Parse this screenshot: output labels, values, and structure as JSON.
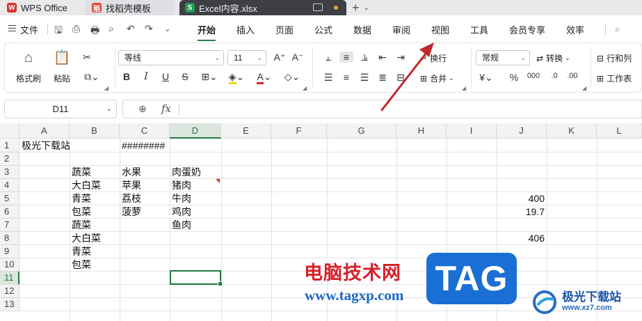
{
  "titlebar": {
    "tabs": [
      {
        "label": "WPS Office",
        "icon": "wps-logo-icon"
      },
      {
        "label": "找稻壳模板",
        "icon": "docer-icon"
      },
      {
        "label": "Excel内容.xlsx",
        "icon": "spreadsheet-icon",
        "badge": "S"
      }
    ],
    "plus": "+"
  },
  "menubar": {
    "file": "文件",
    "tabs": [
      "开始",
      "插入",
      "页面",
      "公式",
      "数据",
      "审阅",
      "视图",
      "工具",
      "会员专享",
      "效率"
    ],
    "active_tab": "开始"
  },
  "ribbon": {
    "format_painter": "格式刷",
    "paste": "粘贴",
    "font_name": "等线",
    "font_size": "11",
    "wrap": "换行",
    "merge": "合并",
    "number_format": "常规",
    "convert": "转换",
    "row_col": "行和列",
    "worksheet": "工作表",
    "currency": "¥",
    "percent": "%",
    "bold": "B",
    "italic": "I",
    "underline": "U",
    "strike": "S",
    "grow_font": "A⁺",
    "shrink_font": "A⁻"
  },
  "formula_bar": {
    "name_box": "D11",
    "fx": "fx",
    "content": ""
  },
  "sheet": {
    "columns": [
      "A",
      "B",
      "C",
      "D",
      "E",
      "F",
      "G",
      "H",
      "I",
      "J",
      "K",
      "L"
    ],
    "rows": [
      "1",
      "2",
      "3",
      "4",
      "5",
      "6",
      "7",
      "8",
      "9",
      "10",
      "11",
      "12",
      "13"
    ],
    "active_cell": "D11",
    "cells": {
      "A1": "极光下载站",
      "C1": "########",
      "B3": "蔬菜",
      "C3": "水果",
      "D3": "肉蛋奶",
      "B4": "大白菜",
      "C4": "苹果",
      "D4": "猪肉",
      "B5": "青菜",
      "C5": "荔枝",
      "D5": "牛肉",
      "J5": "400",
      "B6": "包菜",
      "C6": "菠萝",
      "D6": "鸡肉",
      "J6": "19.7",
      "B7": "蔬菜",
      "D7": "鱼肉",
      "B8": "大白菜",
      "J8": "406",
      "B9": "青菜",
      "B10": "包菜"
    }
  },
  "watermarks": {
    "site_cn": "电脑技术网",
    "site_url": "www.tagxp.com",
    "tag": "TAG",
    "jg_name": "极光下载站",
    "jg_url": "www.xz7.com"
  },
  "colors": {
    "accent_green": "#1f7a3e",
    "annotation_red": "#c0282d",
    "tag_blue": "#1a6fd5"
  }
}
